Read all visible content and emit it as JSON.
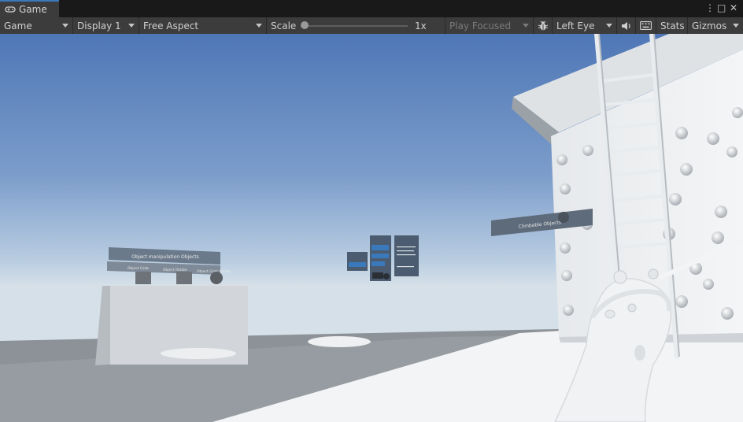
{
  "tab": {
    "title": "Game",
    "icon": "gamepad-icon"
  },
  "window_controls": {
    "menu": "⋮",
    "maximize": "□",
    "close": "✕"
  },
  "toolbar": {
    "mode": "Game",
    "display": "Display 1",
    "aspect": "Free Aspect",
    "scale_label": "Scale",
    "scale_value": "1x",
    "play_focused": "Play Focused",
    "eye": "Left Eye",
    "stats": "Stats",
    "gizmos": "Gizmos"
  },
  "scene": {
    "table_panel_title": "Object manipulation Objects",
    "table_labels": [
      "Object Grab",
      "Object Rotate",
      "Object Grab Rotate"
    ],
    "floating_sign": "Climbable Objects"
  },
  "colors": {
    "sky_top": "#5a82c0",
    "sky_horizon": "#c9d8e6",
    "ground": "#8f969b",
    "panel": "#5f6e80",
    "accent": "#3a79bb"
  }
}
